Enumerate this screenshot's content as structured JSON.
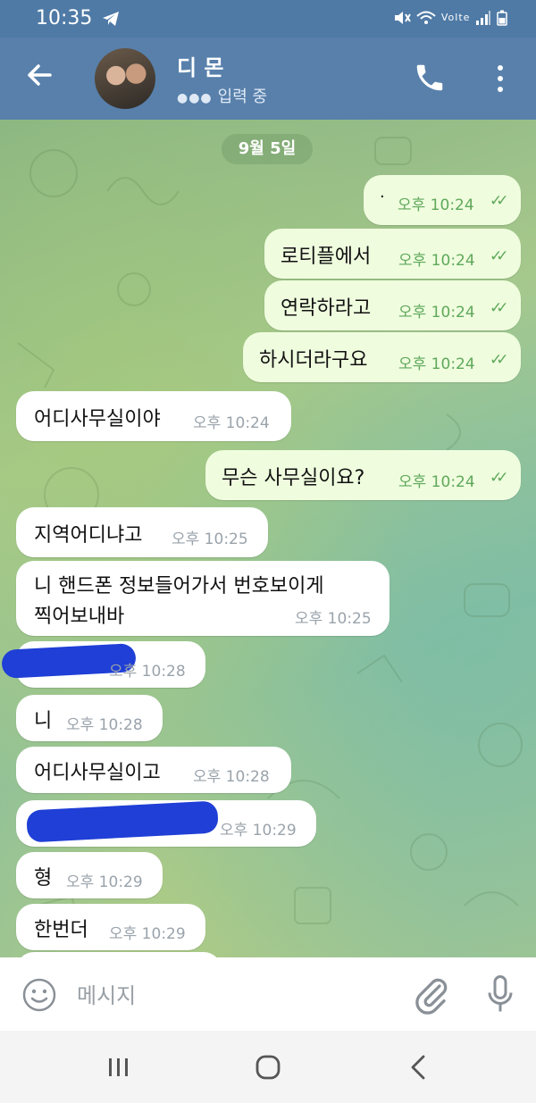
{
  "status_bar": {
    "time": "10:35",
    "network": "Volte"
  },
  "header": {
    "contact_name": "디 몬",
    "typing_status": "입력 중"
  },
  "chat": {
    "date": "9월 5일",
    "messages": [
      {
        "dir": "out",
        "text": "·",
        "time": "오후 10:24",
        "read": true
      },
      {
        "dir": "out",
        "text": "로티플에서",
        "time": "오후 10:24",
        "read": true
      },
      {
        "dir": "out",
        "text": "연락하라고",
        "time": "오후 10:24",
        "read": true
      },
      {
        "dir": "out",
        "text": "하시더라구요",
        "time": "오후 10:24",
        "read": true
      },
      {
        "dir": "in",
        "text": "어디사무실이야",
        "time": "오후 10:24"
      },
      {
        "dir": "out",
        "text": "무슨 사무실이요?",
        "time": "오후 10:24",
        "read": true
      },
      {
        "dir": "in",
        "text": "지역어디냐고",
        "time": "오후 10:25"
      },
      {
        "dir": "in",
        "text_lines": [
          "니 핸드폰 정보들어가서 번호보이게",
          "찍어보내바"
        ],
        "time": "오후 10:25"
      },
      {
        "dir": "in",
        "text": "",
        "time": "오후 10:28",
        "redacted": true
      },
      {
        "dir": "in",
        "text": "니",
        "time": "오후 10:28"
      },
      {
        "dir": "in",
        "text": "어디사무실이고",
        "time": "오후 10:28"
      },
      {
        "dir": "in",
        "text": "",
        "time": "오후 10:29",
        "redacted": true
      },
      {
        "dir": "in",
        "text": "형",
        "time": "오후 10:29"
      },
      {
        "dir": "in",
        "text": "한번더",
        "time": "오후 10:29"
      }
    ]
  },
  "composer": {
    "placeholder": "메시지"
  },
  "colors": {
    "header": "#5880ab",
    "out_bubble": "#effdde",
    "in_bubble": "#ffffff",
    "tick": "#5fa85b",
    "redaction": "#1f3fd6"
  },
  "icons": [
    "back-arrow-icon",
    "phone-icon",
    "more-vert-icon",
    "emoji-icon",
    "attach-icon",
    "mic-icon",
    "nav-recent-icon",
    "nav-home-icon",
    "nav-back-icon"
  ]
}
